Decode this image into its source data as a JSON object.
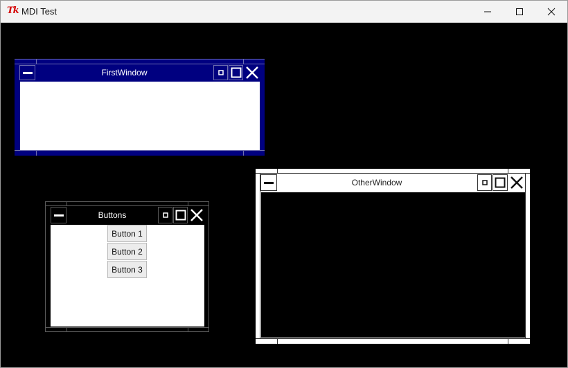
{
  "app": {
    "title": "MDI Test",
    "logo_text": "Tk"
  },
  "window_controls": {
    "minimize_icon": "minimize-icon",
    "maximize_icon": "maximize-icon",
    "close_icon": "close-icon"
  },
  "children": {
    "first": {
      "title": "FirstWindow",
      "frame_color": "#000080",
      "body_color": "#ffffff",
      "title_color": "#ffffff"
    },
    "buttons": {
      "title": "Buttons",
      "frame_color": "#000000",
      "body_color": "#ffffff",
      "title_color": "#ffffff",
      "buttons": [
        {
          "label": "Button 1"
        },
        {
          "label": "Button 2"
        },
        {
          "label": "Button 3"
        }
      ]
    },
    "other": {
      "title": "OtherWindow",
      "frame_color": "#ffffff",
      "body_color": "#000000",
      "title_color": "#222222"
    }
  }
}
